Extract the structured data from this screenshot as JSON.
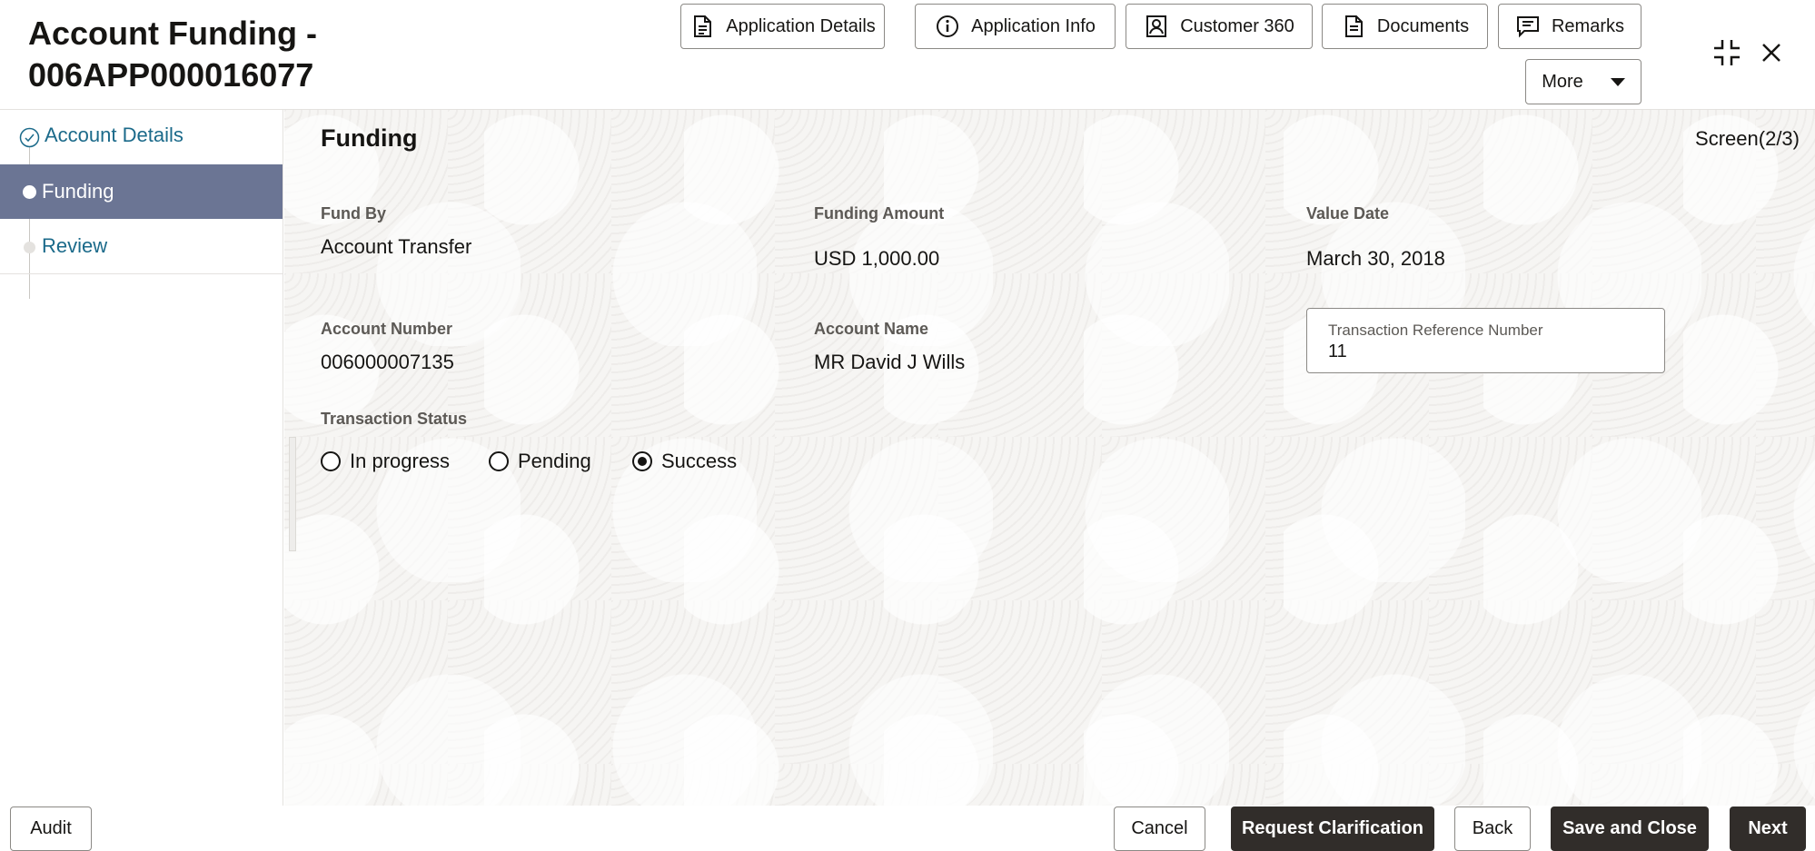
{
  "header": {
    "title_line1": "Account Funding -",
    "title_line2": "006APP000016077",
    "buttons": [
      {
        "label": "Application Details",
        "icon": "document-icon"
      },
      {
        "label": "Application Info",
        "icon": "info-icon"
      },
      {
        "label": "Customer 360",
        "icon": "user-card-icon"
      },
      {
        "label": "Documents",
        "icon": "documents-icon"
      },
      {
        "label": "Remarks",
        "icon": "remarks-icon"
      }
    ],
    "more_label": "More"
  },
  "sidebar": {
    "steps": [
      {
        "label": "Account Details",
        "status": "completed"
      },
      {
        "label": "Funding",
        "status": "active"
      },
      {
        "label": "Review",
        "status": "pending"
      }
    ]
  },
  "main": {
    "section_title": "Funding",
    "screen_indicator": "Screen(2/3)",
    "fields": {
      "fund_by": {
        "label": "Fund By",
        "value": "Account Transfer"
      },
      "funding_amount": {
        "label": "Funding Amount",
        "value": "USD 1,000.00"
      },
      "value_date": {
        "label": "Value Date",
        "value": "March 30, 2018"
      },
      "account_number": {
        "label": "Account Number",
        "value": "006000007135"
      },
      "account_name": {
        "label": "Account Name",
        "value": "MR David J Wills"
      },
      "txn_ref": {
        "label": "Transaction Reference Number",
        "value": "11"
      }
    },
    "transaction_status": {
      "label": "Transaction Status",
      "options": [
        "In progress",
        "Pending",
        "Success"
      ],
      "selected": "Success"
    }
  },
  "footer": {
    "audit": "Audit",
    "cancel": "Cancel",
    "request_clarification": "Request Clarification",
    "back": "Back",
    "save_and_close": "Save and Close",
    "next": "Next"
  },
  "colors": {
    "active_step": "#6b7594",
    "link": "#1b6a8a",
    "dark_button": "#312d2a"
  }
}
